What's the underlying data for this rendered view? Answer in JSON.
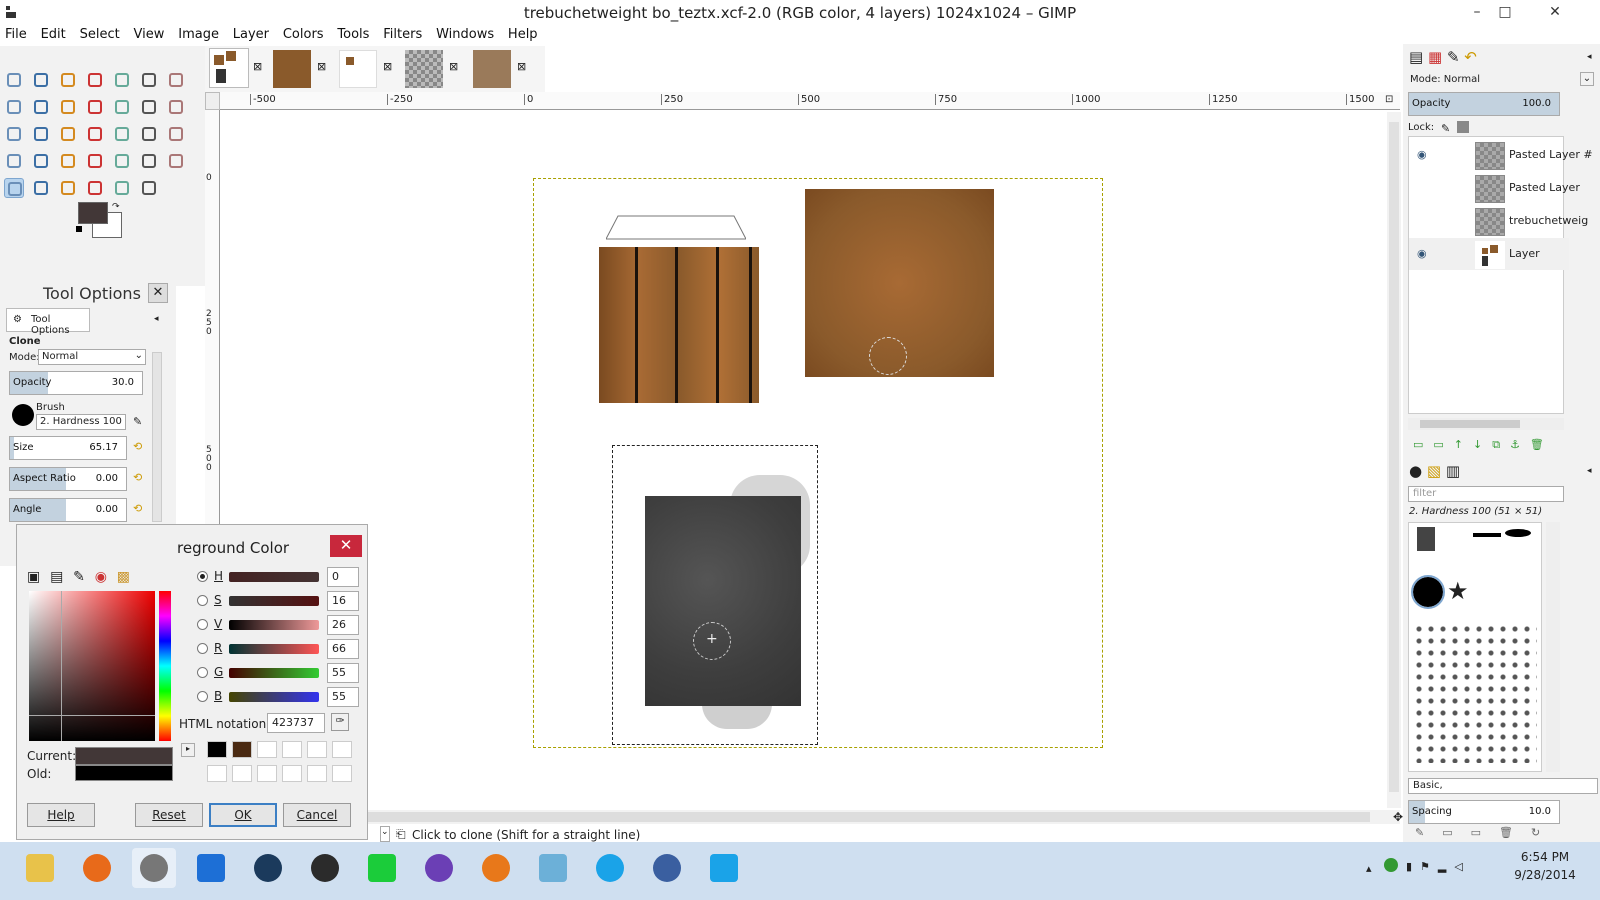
{
  "window": {
    "title": "trebuchetweight bo_teztx.xcf-2.0 (RGB color, 4 layers) 1024x1024 – GIMP",
    "minimize": "–",
    "maximize": "□",
    "close": "✕"
  },
  "menu": [
    "File",
    "Edit",
    "Select",
    "View",
    "Image",
    "Layer",
    "Colors",
    "Tools",
    "Filters",
    "Windows",
    "Help"
  ],
  "image_tabs": [
    "tab-1",
    "tab-2",
    "tab-3",
    "tab-4",
    "tab-5"
  ],
  "toolbox": {
    "tools": [
      "rect-select",
      "ellipse-select",
      "free-select",
      "fuzzy-select",
      "color-select",
      "scissors",
      "foreground-select",
      "paths",
      "color-picker",
      "zoom",
      "measure",
      "move",
      "align",
      "crop",
      "rotate",
      "scale",
      "shear",
      "perspective",
      "flip",
      "cage",
      "text",
      "bucket-fill",
      "blend",
      "pencil",
      "paintbrush",
      "eraser",
      "airbrush",
      "ink",
      "clone",
      "heal",
      "perspective-clone",
      "blur",
      "smudge",
      "dodge-burn"
    ],
    "fg_color": "#423737",
    "bg_color": "#ffffff"
  },
  "tool_options": {
    "title": "Tool Options",
    "tab_label": "Tool Options",
    "tool_name": "Clone",
    "mode_label": "Mode:",
    "mode_value": "Normal",
    "opacity_label": "Opacity",
    "opacity_value": "30.0",
    "brush_label": "Brush",
    "brush_value": "2. Hardness 100",
    "size_label": "Size",
    "size_value": "65.17",
    "aspect_label": "Aspect Ratio",
    "aspect_value": "0.00",
    "angle_label": "Angle",
    "angle_value": "0.00"
  },
  "color_dialog": {
    "title": "reground Color",
    "channels": [
      {
        "id": "H",
        "value": "0",
        "selected": true
      },
      {
        "id": "S",
        "value": "16",
        "selected": false
      },
      {
        "id": "V",
        "value": "26",
        "selected": false
      },
      {
        "id": "R",
        "value": "66",
        "selected": false
      },
      {
        "id": "G",
        "value": "55",
        "selected": false
      },
      {
        "id": "B",
        "value": "55",
        "selected": false
      }
    ],
    "html_label": "HTML notation:",
    "html_value": "423737",
    "current_label": "Current:",
    "old_label": "Old:",
    "current_color": "#423737",
    "old_color": "#000000",
    "history": [
      "#000000",
      "#4a2a12"
    ],
    "buttons": {
      "help": "Help",
      "reset": "Reset",
      "ok": "OK",
      "cancel": "Cancel"
    }
  },
  "rulers": {
    "h_ticks": [
      "-500",
      "-250",
      "0",
      "250",
      "500",
      "750",
      "1000",
      "1250",
      "1500"
    ],
    "v_ticks": [
      "0",
      "250",
      "500"
    ]
  },
  "status": {
    "message": "Click to clone (Shift for a straight line)"
  },
  "layers_panel": {
    "mode_label": "Mode: Normal",
    "opacity_label": "Opacity",
    "opacity_value": "100.0",
    "lock_label": "Lock:",
    "layers": [
      {
        "name": "Pasted Layer #",
        "visible": true
      },
      {
        "name": "Pasted Layer",
        "visible": false
      },
      {
        "name": "trebuchetweig",
        "visible": false
      },
      {
        "name": "Layer",
        "visible": true
      }
    ]
  },
  "brushes_panel": {
    "filter_placeholder": "filter",
    "brush_name": "2. Hardness 100 (51 × 51)",
    "preset": "Basic,",
    "spacing_label": "Spacing",
    "spacing_value": "10.0"
  },
  "taskbar": {
    "apps": [
      "file-explorer",
      "firefox",
      "gimp",
      "app-blue",
      "steam",
      "razer",
      "green-cloud",
      "visual-studio",
      "blender",
      "paint",
      "skype",
      "calendar-app",
      "skype-2"
    ],
    "time": "6:54 PM",
    "date": "9/28/2014"
  },
  "colors": {
    "accent": "#b8d4ee",
    "wood": "#8a5a2b",
    "stone": "#3e3e3e"
  }
}
